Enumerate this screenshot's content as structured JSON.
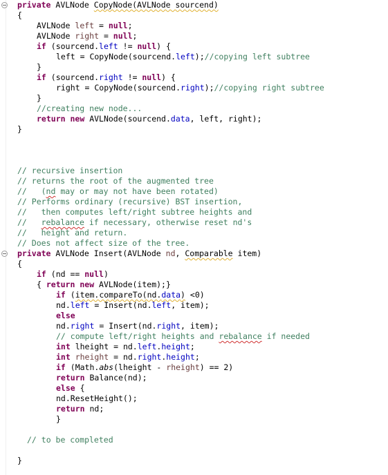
{
  "editor": {
    "language": "Java",
    "method1": {
      "signature": {
        "kw": "private",
        "type": " AVLNode ",
        "name": "CopyNode(AVLNode sourcend)"
      },
      "open_brace": "{",
      "l1": {
        "a": "AVLNode ",
        "b": "left",
        "c": " = ",
        "d": "null",
        "e": ";"
      },
      "l2": {
        "a": "AVLNode ",
        "b": "right",
        "c": " = ",
        "d": "null",
        "e": ";"
      },
      "l3": {
        "a": "if",
        "b": " (sourcend.",
        "c": "left",
        "d": " != ",
        "e": "null",
        "f": ") {"
      },
      "l4": {
        "a": "left = CopyNode(sourcend.",
        "b": "left",
        "c": ");",
        "d": "//copying left subtree"
      },
      "l5": "}",
      "l6": {
        "a": "if",
        "b": " (sourcend.",
        "c": "right",
        "d": " != ",
        "e": "null",
        "f": ") {"
      },
      "l7": {
        "a": "right = CopyNode(sourcend.",
        "b": "right",
        "c": ");",
        "d": "//copying right subtree"
      },
      "l8": "}",
      "l9": "//creating new node...",
      "l10": {
        "a": "return",
        "b": "new",
        "c": " AVLNode(sourcend.",
        "d": "data",
        "e": ", left, right);"
      },
      "close_brace": "}"
    },
    "comments": [
      "// recursive insertion",
      "// returns the root of the augmented tree",
      "//   (",
      "nd",
      " may or may not have been rotated)",
      "// Performs ordinary (recursive) BST insertion,",
      "//   then computes left/right subtree heights and",
      "//   ",
      "rebalance",
      " if necessary, otherwise reset nd's",
      "//   height and return.",
      "// Does not affect size of the tree."
    ],
    "method2": {
      "signature": {
        "kw": "private",
        "a": " AVLNode Insert(AVLNode ",
        "nd": "nd",
        "b": ", ",
        "comparable": "Comparable",
        "c": " item)"
      },
      "open_brace": "{",
      "l1": {
        "a": "if",
        "b": " (nd == ",
        "c": "null",
        "d": ")"
      },
      "l2": {
        "a": "{ ",
        "b": "return",
        "c": "new",
        "d": " AVLNode(item);}"
      },
      "l3": {
        "a": "if",
        "b": " (",
        "c": "item.compareTo(nd.",
        "d": "data",
        "e": ")",
        "f": " <0)"
      },
      "l4": {
        "a": "nd.",
        "b": "left",
        "c": " = Insert(nd.",
        "d": "left",
        "e": ", item);"
      },
      "l5": "else",
      "l6": {
        "a": "nd.",
        "b": "right",
        "c": " = Insert(nd.",
        "d": "right",
        "e": ", item);"
      },
      "l7": {
        "a": "// compute left/right heights and ",
        "b": "rebalance",
        "c": " if needed"
      },
      "l8": {
        "a": "int",
        "b": " lheight = nd.",
        "c": "left",
        "d": ".",
        "e": "height",
        "f": ";"
      },
      "l9": {
        "a": "int",
        "b": " rheight",
        "c": " = nd.",
        "d": "right",
        "e": ".",
        "f": "height",
        "g": ";"
      },
      "l10": {
        "a": "if",
        "b": " (Math.",
        "c": "abs",
        "d": "(lheight - ",
        "e": "rheight",
        "f": ") == 2)"
      },
      "l11": {
        "a": "return",
        "b": " Balance(nd);"
      },
      "l12": {
        "a": "else",
        "b": " {"
      },
      "l13": "nd.ResetHeight();",
      "l14": {
        "a": "return",
        "b": " nd;"
      },
      "l15": "}",
      "todo": "// to be completed",
      "close_brace": "}"
    }
  }
}
